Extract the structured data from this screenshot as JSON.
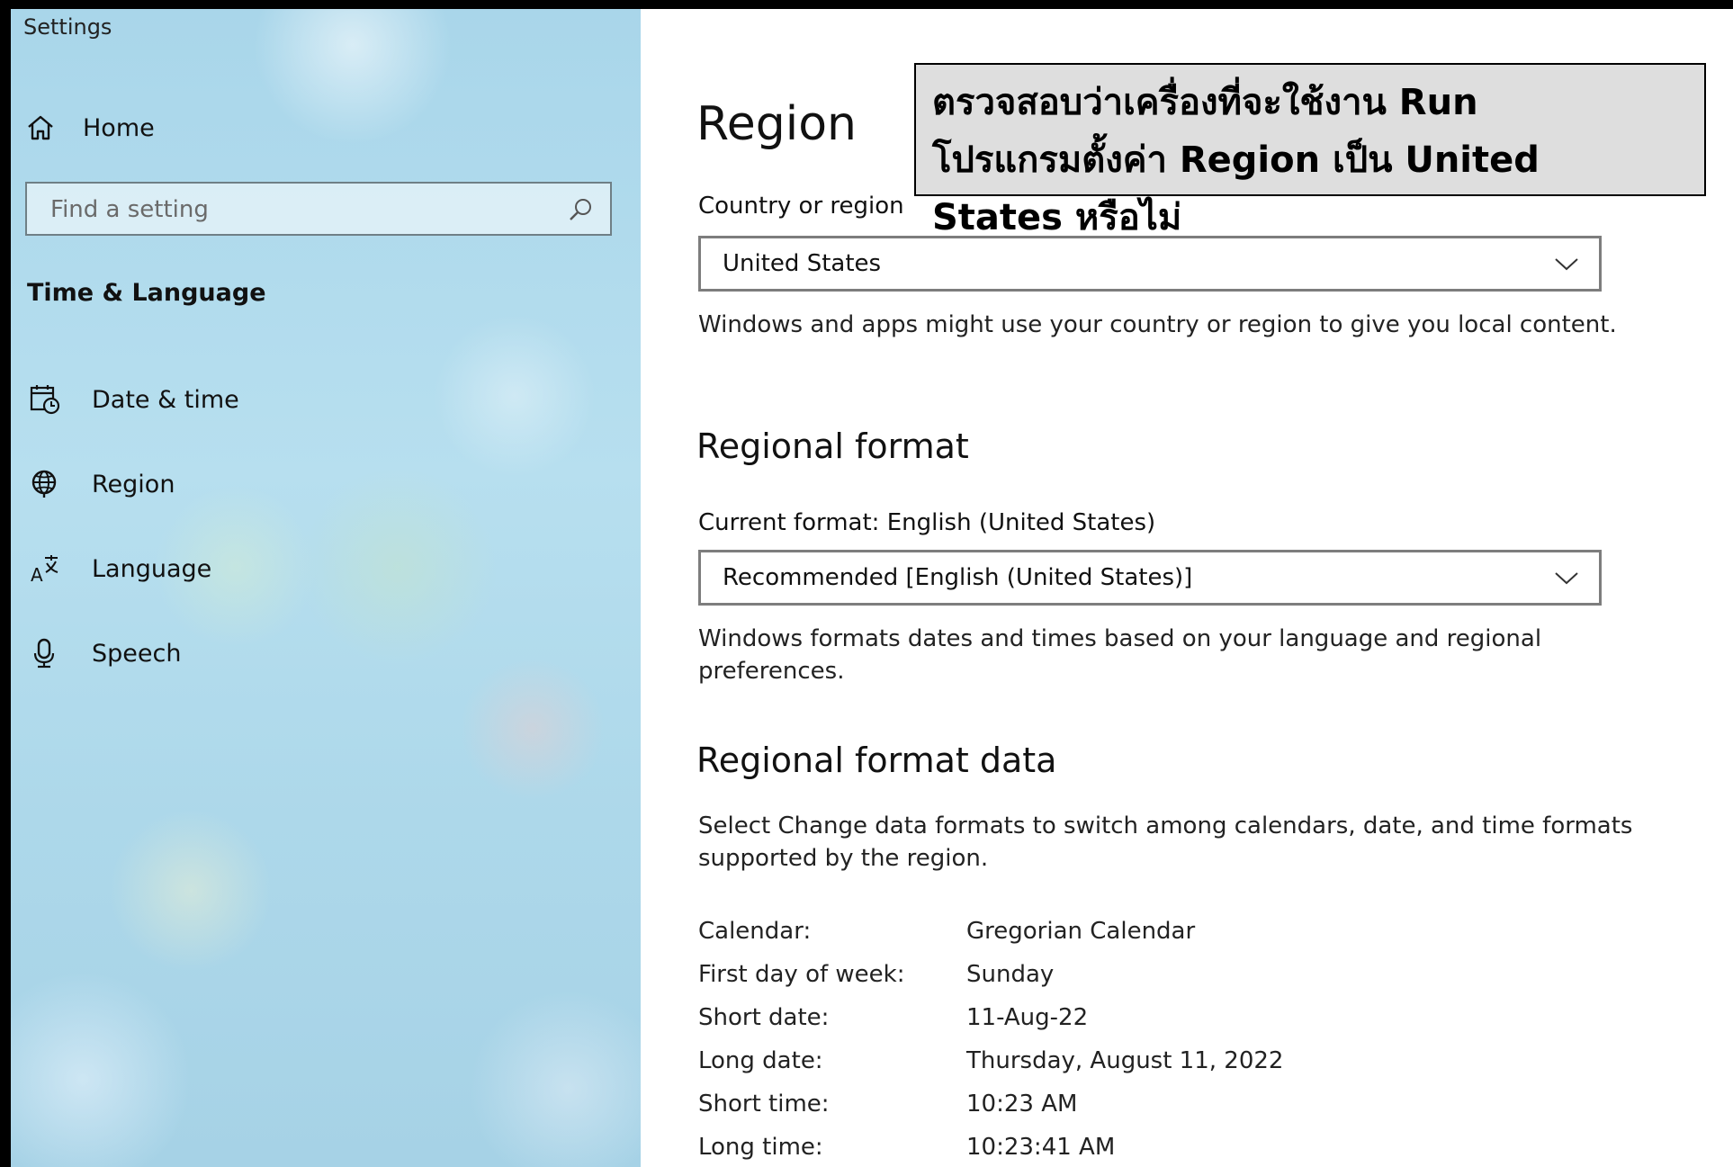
{
  "window": {
    "title": "Settings"
  },
  "sidebar": {
    "home_label": "Home",
    "search": {
      "placeholder": "Find a setting"
    },
    "section_title": "Time & Language",
    "items": [
      {
        "label": "Date & time",
        "icon": "calendar-clock-icon"
      },
      {
        "label": "Region",
        "icon": "globe-icon"
      },
      {
        "label": "Language",
        "icon": "language-icon"
      },
      {
        "label": "Speech",
        "icon": "microphone-icon"
      }
    ]
  },
  "main": {
    "title": "Region",
    "country": {
      "label": "Country or region",
      "value": "United States",
      "description": "Windows and apps might use your country or region to give you local content."
    },
    "regional_format": {
      "heading": "Regional format",
      "current_label": "Current format: English (United States)",
      "value": "Recommended [English (United States)]",
      "description": "Windows formats dates and times based on your language and regional preferences."
    },
    "format_data": {
      "heading": "Regional format data",
      "description": "Select Change data formats to switch among calendars, date, and time formats supported by the region.",
      "rows": [
        {
          "label": "Calendar:",
          "value": "Gregorian Calendar"
        },
        {
          "label": "First day of week:",
          "value": "Sunday"
        },
        {
          "label": "Short date:",
          "value": "11-Aug-22"
        },
        {
          "label": "Long date:",
          "value": "Thursday, August 11, 2022"
        },
        {
          "label": "Short time:",
          "value": "10:23 AM"
        },
        {
          "label": "Long time:",
          "value": "10:23:41 AM"
        }
      ]
    }
  },
  "annotation": {
    "line1": "ตรวจสอบว่าเครื่องที่จะใช้งาน Run",
    "line2": "โปรแกรมตั้งค่า Region เป็น United",
    "line3": "States หรือไม่"
  }
}
